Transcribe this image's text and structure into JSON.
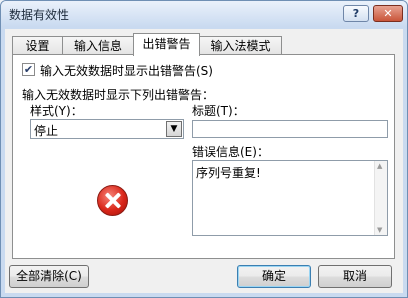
{
  "window": {
    "title": "数据有效性",
    "help_label": "?",
    "close_label": "✕"
  },
  "tabs": [
    {
      "label": "设置",
      "active": false
    },
    {
      "label": "输入信息",
      "active": false
    },
    {
      "label": "出错警告",
      "active": true
    },
    {
      "label": "输入法模式",
      "active": false
    }
  ],
  "error_alert": {
    "show_alert_checkbox": {
      "label": "输入无效数据时显示出错警告(S)",
      "checked": true,
      "check_glyph": "✔"
    },
    "section_label": "输入无效数据时显示下列出错警告：",
    "style_label": "样式(Y)：",
    "style_value": "停止",
    "combo_arrow": "▼",
    "title_label": "标题(T)：",
    "title_value": "",
    "message_label": "错误信息(E)：",
    "message_value": "序列号重复!",
    "scroll_up": "▲",
    "scroll_down": "▼",
    "icon": "error-stop-icon"
  },
  "buttons": {
    "clear_all": "全部清除(C)",
    "ok": "确定",
    "cancel": "取消"
  }
}
